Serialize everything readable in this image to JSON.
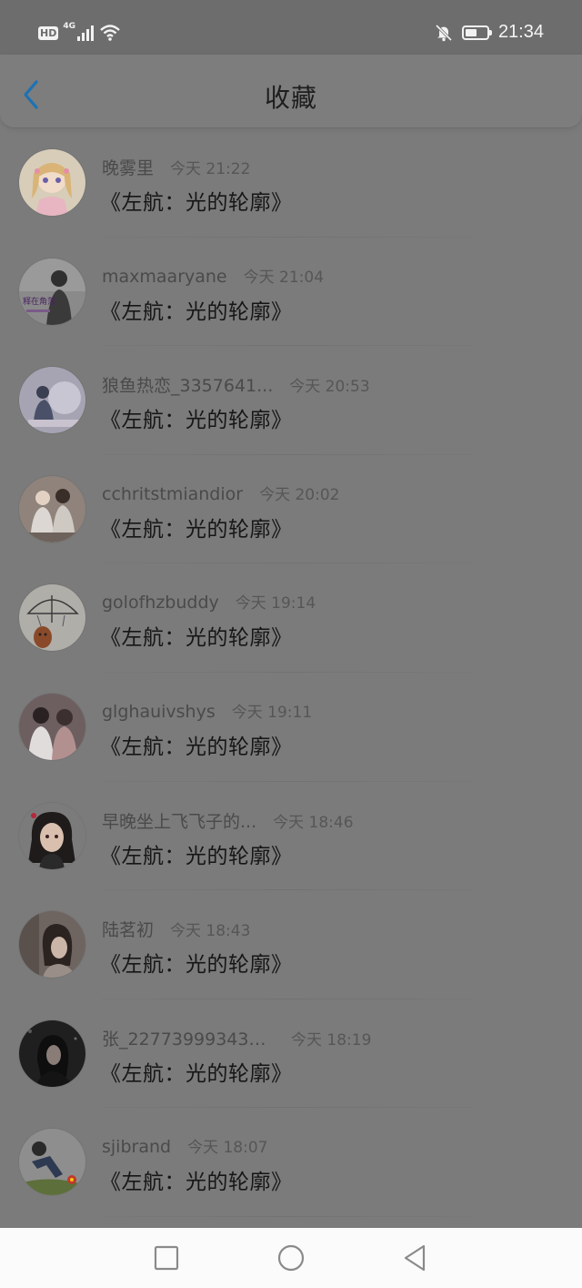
{
  "status_bar": {
    "hd": "HD",
    "network": "4G",
    "time": "21:34",
    "battery_level": 0.55
  },
  "header": {
    "title": "收藏"
  },
  "favorites": [
    {
      "name": "晚雾里",
      "time": "今天 21:22",
      "title": "《左航：光的轮廓》"
    },
    {
      "name": "maxmaaryane",
      "time": "今天 21:04",
      "title": "《左航：光的轮廓》"
    },
    {
      "name": "狼鱼热恋_3357641...",
      "time": "今天 20:53",
      "title": "《左航：光的轮廓》"
    },
    {
      "name": "cchritstmiandior",
      "time": "今天 20:02",
      "title": "《左航：光的轮廓》"
    },
    {
      "name": "golofhzbuddy",
      "time": "今天 19:14",
      "title": "《左航：光的轮廓》"
    },
    {
      "name": "glghauivshys",
      "time": "今天 19:11",
      "title": "《左航：光的轮廓》"
    },
    {
      "name": "早晚坐上飞飞子的...",
      "time": "今天 18:46",
      "title": "《左航：光的轮廓》"
    },
    {
      "name": "陆茗初",
      "time": "今天 18:43",
      "title": "《左航：光的轮廓》"
    },
    {
      "name": "张_227739993434...",
      "time": "今天 18:19",
      "title": "《左航：光的轮廓》"
    },
    {
      "name": "sjibrand",
      "time": "今天 18:07",
      "title": "《左航：光的轮廓》"
    }
  ],
  "avatar_art": [
    {
      "bg": "#cfc3a8",
      "fg": "#b89a7a"
    },
    {
      "bg": "#7e7e7e",
      "fg": "#3c3c3c",
      "caption": "释在角落"
    },
    {
      "bg": "#a9a8b6",
      "fg": "#4a5060"
    },
    {
      "bg": "#9c8f87",
      "fg": "#d9d6d2"
    },
    {
      "bg": "#b2b0aa",
      "fg": "#8a4a2a"
    },
    {
      "bg": "#6c5e5e",
      "fg": "#d4cfcf"
    },
    {
      "bg": "#7b7b7b",
      "fg": "#1d1d1d"
    },
    {
      "bg": "#6f6561",
      "fg": "#2e2622"
    },
    {
      "bg": "#232323",
      "fg": "#555555"
    },
    {
      "bg": "#8e8e8e",
      "fg": "#2e3a52"
    }
  ],
  "icons": {
    "back": "chevron-left-icon",
    "signal": "signal-bars-icon",
    "wifi": "wifi-icon",
    "mute": "bell-off-icon",
    "battery": "battery-icon",
    "nav_recent": "square-icon",
    "nav_home": "circle-icon",
    "nav_back": "triangle-back-icon"
  },
  "colors": {
    "accent": "#1b72b4"
  }
}
